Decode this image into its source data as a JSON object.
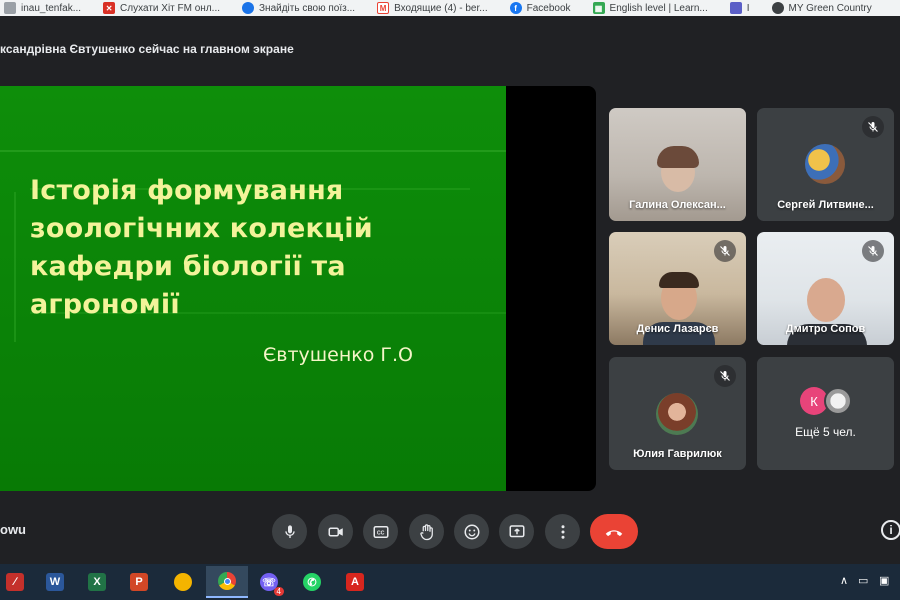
{
  "bookmarks": [
    {
      "label": "inau_tenfak...",
      "icon": "generic-icon",
      "color": "#5f6368"
    },
    {
      "label": "Слухати Хіт FM онл...",
      "icon": "xit-fm-icon",
      "color": "#d93025"
    },
    {
      "label": "Знайдіть свою поїз...",
      "icon": "train-icon",
      "color": "#1a73e8"
    },
    {
      "label": "Входящие (4) - ber...",
      "icon": "gmail-icon",
      "color": "#ea4335"
    },
    {
      "label": "Facebook",
      "icon": "facebook-icon",
      "color": "#1877f2"
    },
    {
      "label": "English level | Learn...",
      "icon": "learn-icon",
      "color": "#34a853"
    },
    {
      "label": "I",
      "icon": "teams-icon",
      "color": "#5b5fc7"
    },
    {
      "label": "MY Green Country",
      "icon": "mygreen-icon",
      "color": "#3c4043"
    }
  ],
  "header": {
    "presenter_banner": "ксандрівна Євтушенко сейчас на главном экране"
  },
  "slide": {
    "title_lines": [
      "Історія формування",
      "зоологічних колекцій",
      "кафедри біології та",
      "агрономії"
    ],
    "author": "Євтушенко Г.О"
  },
  "participants": [
    {
      "name": "Галина Олексан...",
      "muted": false,
      "type": "video"
    },
    {
      "name": "Сергей Литвине...",
      "muted": true,
      "type": "avatar"
    },
    {
      "name": "Денис Лазарєв",
      "muted": true,
      "type": "video"
    },
    {
      "name": "Дмитро Сопов",
      "muted": true,
      "type": "video"
    },
    {
      "name": "Юлия Гаврилюк",
      "muted": true,
      "type": "avatar"
    }
  ],
  "more_tile": {
    "label": "Ещё 5 чел.",
    "avatar_letter": "К"
  },
  "bottom_bar": {
    "meeting_code": "owu",
    "info": "i"
  },
  "taskbar": {
    "apps": [
      "acrobat-reader",
      "word",
      "excel",
      "powerpoint",
      "slides",
      "chrome",
      "viber",
      "whatsapp",
      "adobe-pdf"
    ],
    "viber_badge": "4"
  },
  "colors": {
    "meet_bg": "#202124",
    "tile_bg": "#3c4043",
    "slide_green": "#0e8e0a",
    "slide_title": "#f3f39a",
    "end_call": "#ea4335"
  }
}
